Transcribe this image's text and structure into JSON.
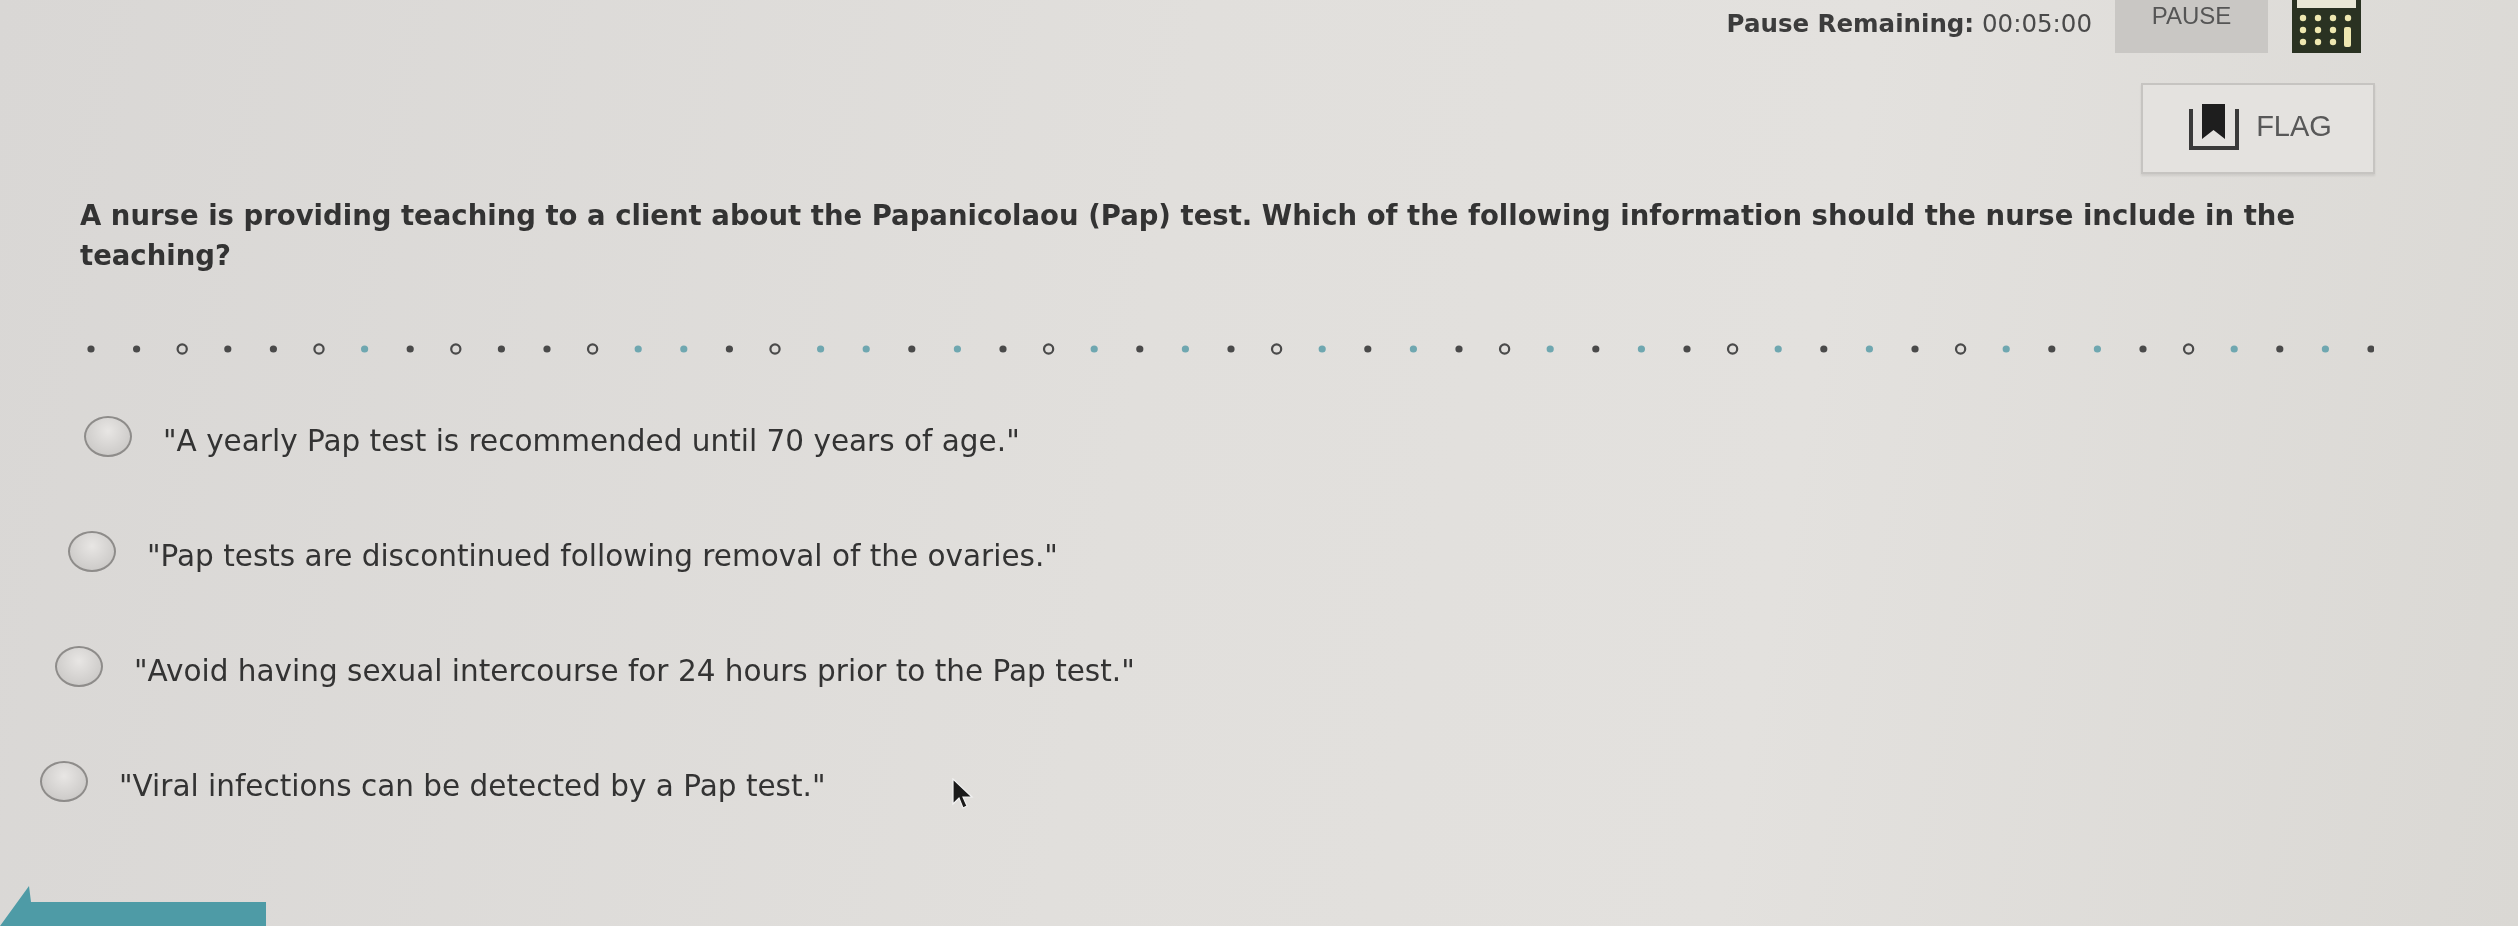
{
  "header": {
    "pause_remaining": "**Pause Remaining:** 00:05:00",
    "pause_button": "PAUSE",
    "flag_button": "FLAG"
  },
  "question": {
    "text": "A nurse is providing teaching to a client about the Papanicolaou (Pap) test. Which of the following information should the nurse include in the teaching?"
  },
  "options": [
    {
      "text": "\"A yearly Pap test is recommended until 70 years of age.\"",
      "selected": false
    },
    {
      "text": "\"Pap tests are discontinued following removal of the ovaries.\"",
      "selected": false
    },
    {
      "text": "\"Avoid having sexual intercourse for 24 hours prior to the Pap test.\"",
      "selected": false
    },
    {
      "text": "\"Viral infections can be detected by a Pap test.\"",
      "selected": false
    }
  ]
}
